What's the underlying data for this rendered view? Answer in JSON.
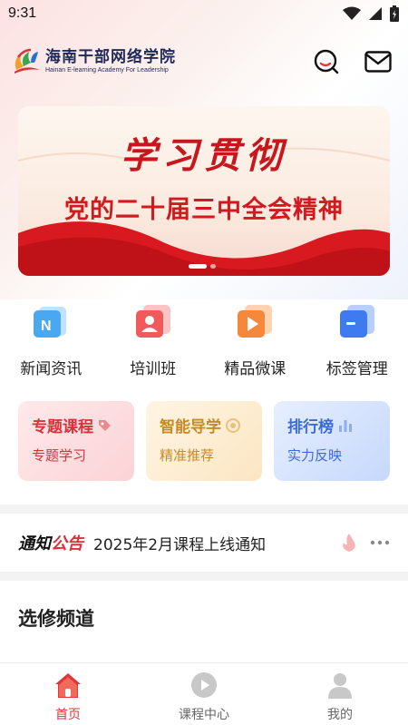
{
  "status_bar": {
    "time": "9:31"
  },
  "header": {
    "title": "海南干部网络学院",
    "subtitle": "Hainan E-learning Academy For Leadership"
  },
  "banner": {
    "calligraphy": "学习贯彻",
    "headline": "党的二十届三中全会精神"
  },
  "quick_nav": [
    {
      "label": "新闻资讯",
      "icon": "news-icon",
      "color": "#4aa8f0"
    },
    {
      "label": "培训班",
      "icon": "training-icon",
      "color": "#f05a5a"
    },
    {
      "label": "精品微课",
      "icon": "video-icon",
      "color": "#f5883a"
    },
    {
      "label": "标签管理",
      "icon": "tag-icon",
      "color": "#3f7bf0"
    }
  ],
  "feature_cards": [
    {
      "title": "专题课程",
      "sub": "专题学习",
      "theme": "red",
      "icon": "tag-icon"
    },
    {
      "title": "智能导学",
      "sub": "精准推荐",
      "theme": "yellow",
      "icon": "target-icon"
    },
    {
      "title": "排行榜",
      "sub": "实力反映",
      "theme": "blue",
      "icon": "bar-chart-icon"
    }
  ],
  "notice": {
    "tag_a": "通知",
    "tag_b": "公告",
    "text": "2025年2月课程上线通知"
  },
  "section": {
    "title": "选修频道"
  },
  "bottom_nav": [
    {
      "label": "首页",
      "icon": "home-icon",
      "active": true
    },
    {
      "label": "课程中心",
      "icon": "play-icon",
      "active": false
    },
    {
      "label": "我的",
      "icon": "user-icon",
      "active": false
    }
  ],
  "colors": {
    "accent": "#e2343a",
    "brand_navy": "#1f2a5a"
  }
}
